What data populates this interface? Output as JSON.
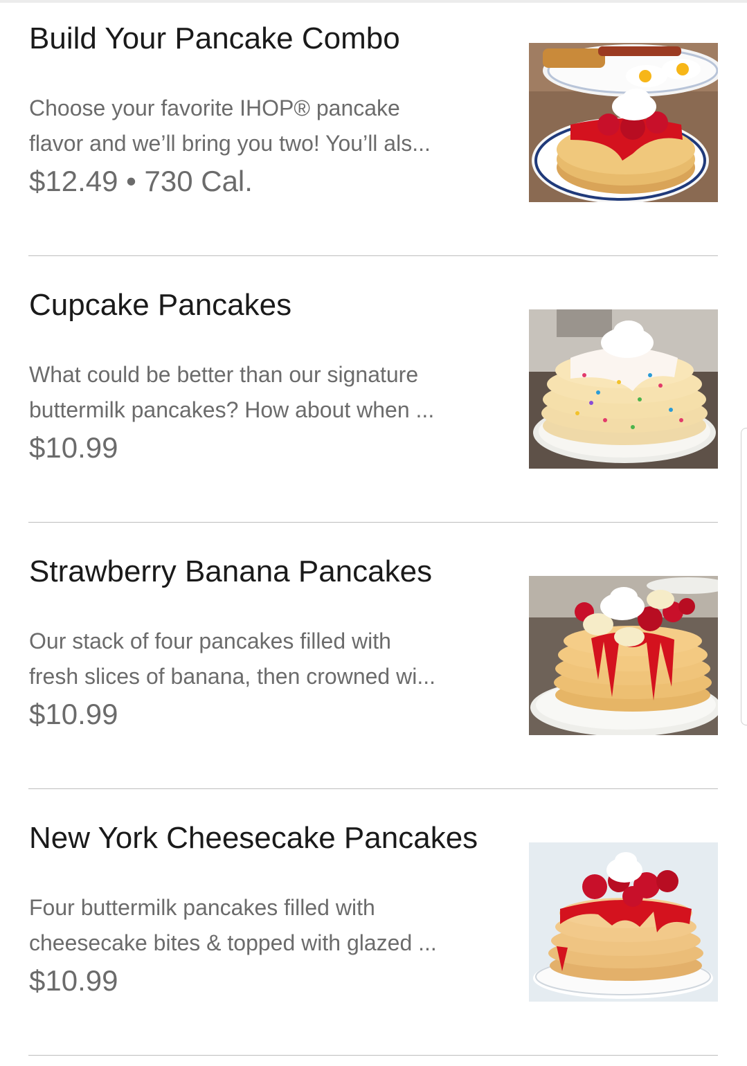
{
  "menu": {
    "items": [
      {
        "title": "Build Your Pancake Combo",
        "description_lines": [
          "Choose your favorite IHOP® pancake",
          "flavor and we’ll bring you two! You’ll als..."
        ],
        "price": "$12.49 • 730 Cal.",
        "image_icon": "pancake-combo-photo"
      },
      {
        "title": "Cupcake Pancakes",
        "description_lines": [
          "What could be better than our signature",
          "buttermilk pancakes? How about when ..."
        ],
        "price": "$10.99",
        "image_icon": "cupcake-pancakes-photo"
      },
      {
        "title": "Strawberry Banana Pancakes",
        "description_lines": [
          "Our stack of four pancakes filled with",
          "fresh slices of banana, then crowned wi..."
        ],
        "price": "$10.99",
        "image_icon": "strawberry-banana-pancakes-photo"
      },
      {
        "title": "New York Cheesecake Pancakes",
        "description_lines": [
          "Four buttermilk pancakes filled with",
          "cheesecake bites & topped with glazed ..."
        ],
        "price": "$10.99",
        "image_icon": "cheesecake-pancakes-photo"
      }
    ]
  },
  "colors": {
    "title_text": "#1a1a1a",
    "secondary_text": "#6b6b6b",
    "divider": "#bdbdbd",
    "pancake": "#e8b86a",
    "syrup_red": "#d4121e",
    "cream": "#ffffff"
  }
}
